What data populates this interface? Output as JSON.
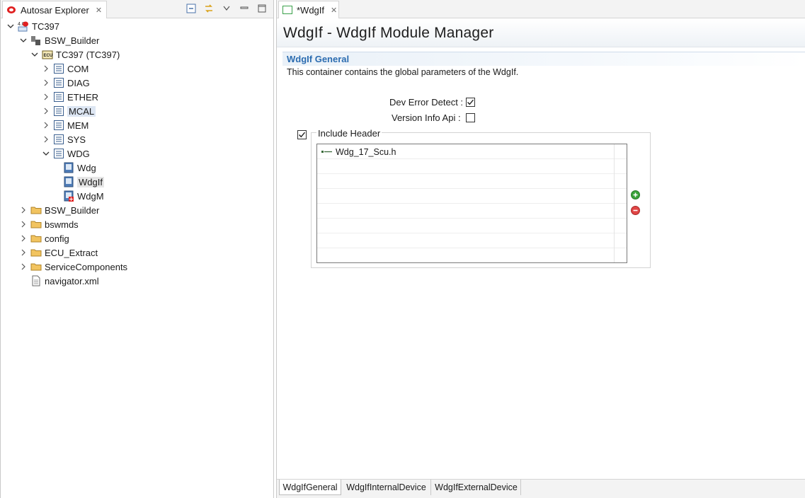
{
  "explorer": {
    "tab_label": "Autosar Explorer",
    "tree": [
      {
        "label": "TC397",
        "level": 0,
        "expanded": true,
        "icon": "autosar-project-icon"
      },
      {
        "label": "BSW_Builder",
        "level": 1,
        "expanded": true,
        "icon": "builder-icon"
      },
      {
        "label": "TC397 (TC397)",
        "level": 2,
        "expanded": true,
        "icon": "ecu-icon"
      },
      {
        "label": "COM",
        "level": 3,
        "expanded": false,
        "icon": "module-list-icon"
      },
      {
        "label": "DIAG",
        "level": 3,
        "expanded": false,
        "icon": "module-list-icon"
      },
      {
        "label": "ETHER",
        "level": 3,
        "expanded": false,
        "icon": "module-list-icon"
      },
      {
        "label": "MCAL",
        "level": 3,
        "expanded": false,
        "icon": "module-list-icon"
      },
      {
        "label": "MEM",
        "level": 3,
        "expanded": false,
        "icon": "module-list-icon"
      },
      {
        "label": "SYS",
        "level": 3,
        "expanded": false,
        "icon": "module-list-icon"
      },
      {
        "label": "WDG",
        "level": 3,
        "expanded": true,
        "icon": "module-list-icon"
      },
      {
        "label": "Wdg",
        "level": 4,
        "icon": "module-file-icon"
      },
      {
        "label": "WdgIf",
        "level": 4,
        "icon": "module-file-icon"
      },
      {
        "label": "WdgM",
        "level": 4,
        "icon": "module-file-error-icon"
      },
      {
        "label": "BSW_Builder",
        "level": 1,
        "expanded": false,
        "icon": "folder-icon"
      },
      {
        "label": "bswmds",
        "level": 1,
        "expanded": false,
        "icon": "folder-icon"
      },
      {
        "label": "config",
        "level": 1,
        "expanded": false,
        "icon": "folder-icon"
      },
      {
        "label": "ECU_Extract",
        "level": 1,
        "expanded": false,
        "icon": "folder-icon"
      },
      {
        "label": "ServiceComponents",
        "level": 1,
        "expanded": false,
        "icon": "folder-icon"
      },
      {
        "label": "navigator.xml",
        "level": 1,
        "icon": "xml-file-icon"
      }
    ]
  },
  "editor": {
    "tab_label": "*WdgIf",
    "form_title": "WdgIf - WdgIf Module Manager",
    "section_title": "WdgIf General",
    "section_description": "This container contains the global parameters of the WdgIf.",
    "dev_error_detect_label": "Dev Error Detect :",
    "dev_error_detect_checked": true,
    "version_info_api_label": "Version Info Api :",
    "version_info_api_checked": false,
    "include_header_label": "Include Header",
    "include_header_checked": true,
    "include_headers": [
      "Wdg_17_Scu.h"
    ],
    "add_icon": "add-icon",
    "remove_icon": "remove-icon",
    "bottom_tabs": [
      "WdgIfGeneral",
      "WdgIfInternalDevice",
      "WdgIfExternalDevice"
    ],
    "active_bottom_tab": "WdgIfGeneral"
  }
}
